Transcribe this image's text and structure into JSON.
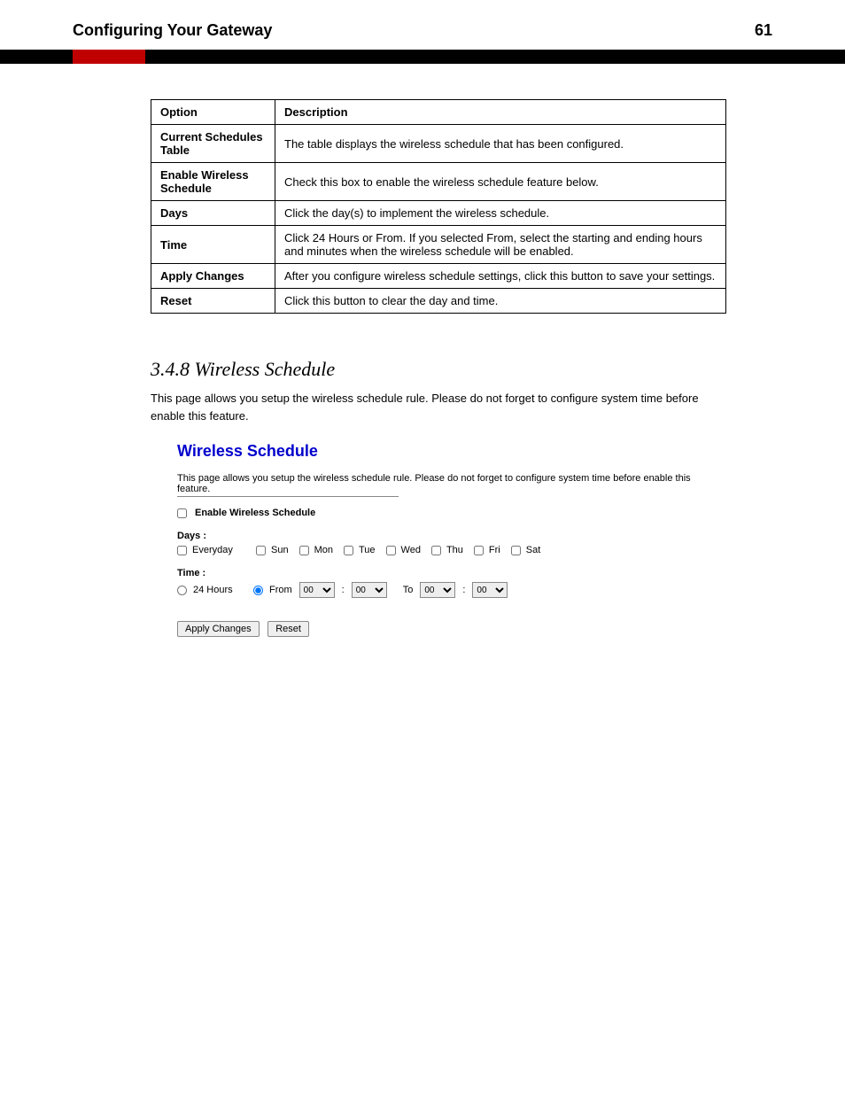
{
  "page_header": {
    "title": "Configuring Your Gateway",
    "pageno": "61"
  },
  "param_table": {
    "cols": [
      "Option",
      "Description"
    ],
    "rows": [
      {
        "param": "Current Schedules Table",
        "desc": "The table displays the wireless schedule that has been configured."
      },
      {
        "param": "Enable Wireless Schedule",
        "desc": "Check this box to enable the wireless schedule feature below."
      },
      {
        "param": "Days",
        "desc": "Click the day(s) to implement the wireless schedule."
      },
      {
        "param": "Time",
        "desc": "Click 24 Hours or From. If you selected From, select the starting and ending hours and minutes when the wireless schedule will be enabled."
      },
      {
        "param": "Apply Changes",
        "desc": "After you configure wireless schedule settings, click this button to save your settings."
      },
      {
        "param": "Reset",
        "desc": "Click this button to clear the day and time."
      }
    ]
  },
  "section": {
    "heading": "3.4.8 Wireless Schedule",
    "intro": "This page allows you setup the wireless schedule rule. Please do not forget to configure system time before enable this feature."
  },
  "screenshot": {
    "title": "Wireless Schedule",
    "intro": "This page allows you setup the wireless schedule rule. Please do not forget to configure system time before enable this feature.",
    "enable_label": "Enable Wireless Schedule",
    "days_label": "Days :",
    "days": [
      "Everyday",
      "Sun",
      "Mon",
      "Tue",
      "Wed",
      "Thu",
      "Fri",
      "Sat"
    ],
    "time_label": "Time :",
    "time_24": "24 Hours",
    "time_from": "From",
    "time_to": "To",
    "colon": ":",
    "select_val": "00",
    "apply_btn": "Apply Changes",
    "reset_btn": "Reset"
  }
}
